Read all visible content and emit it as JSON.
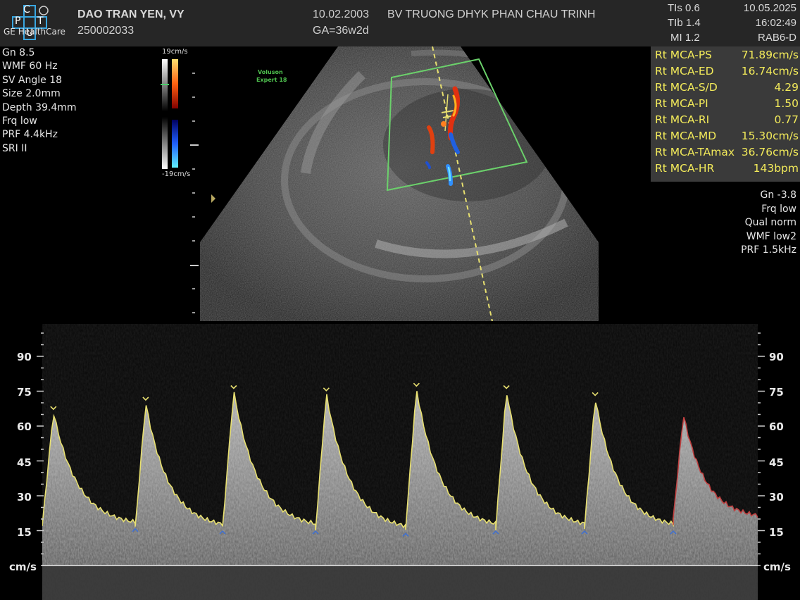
{
  "header": {
    "logo_text": "GE HealthCare",
    "logo_letters": [
      "C",
      "P",
      "T",
      "U"
    ],
    "patient_name": "DAO TRAN YEN, VY",
    "patient_id": "250002033",
    "dob": "10.02.2003",
    "ga": "GA=36w2d",
    "hospital": "BV TRUONG DHYK PHAN CHAU TRINH",
    "tis": "TIs  0.6",
    "tib": "TIb  1.4",
    "mi": "MI  1.2",
    "date": "10.05.2025",
    "time": "16:02:49",
    "probe": "RAB6-D"
  },
  "left_params": [
    "Gn  8.5",
    "WMF 60 Hz",
    "SV Angle 18",
    "Size  2.0mm",
    "Depth 39.4mm",
    "Frq low",
    "PRF  4.4kHz",
    "SRI II"
  ],
  "color_scale": {
    "top": "19cm/s",
    "bottom": "-19cm/s"
  },
  "voluson_label": [
    "Voluson",
    "Expert 18"
  ],
  "measurements": [
    {
      "label": "Rt MCA-PS",
      "value": "71.89cm/s"
    },
    {
      "label": "Rt MCA-ED",
      "value": "16.74cm/s"
    },
    {
      "label": "Rt MCA-S/D",
      "value": "4.29"
    },
    {
      "label": "Rt MCA-PI",
      "value": "1.50"
    },
    {
      "label": "Rt MCA-RI",
      "value": "0.77"
    },
    {
      "label": "Rt MCA-MD",
      "value": "15.30cm/s"
    },
    {
      "label": "Rt MCA-TAmax",
      "value": "36.76cm/s"
    },
    {
      "label": "Rt MCA-HR",
      "value": "143bpm"
    }
  ],
  "right_params": [
    "Gn -3.8",
    "Frq low",
    "Qual norm",
    "WMF low2",
    "PRF  1.5kHz"
  ],
  "doppler_axis": {
    "ticks": [
      "90",
      "75",
      "60",
      "45",
      "30",
      "15"
    ],
    "unit": "cm/s"
  },
  "colors": {
    "measure_text": "#f2ea5a",
    "trace": "#e8e070",
    "trace_last": "#c04040",
    "roi": "#6bd16b"
  }
}
